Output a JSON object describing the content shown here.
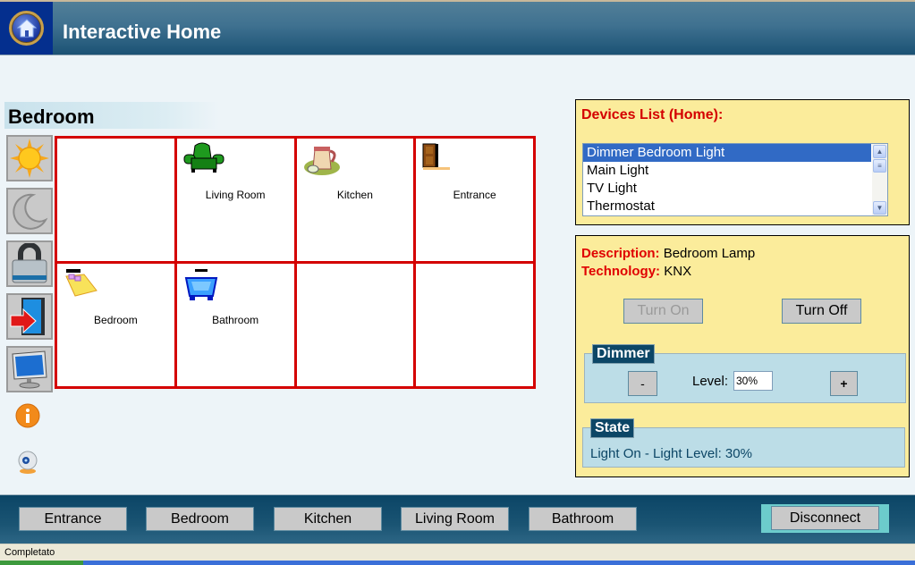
{
  "header": {
    "title": "Interactive Home",
    "logo_icon": "home-icon"
  },
  "room": {
    "title": "Bedroom"
  },
  "sidebar": {
    "buttons": [
      {
        "name": "day-scene",
        "icon": "sun-icon"
      },
      {
        "name": "night-scene",
        "icon": "moon-icon"
      },
      {
        "name": "security",
        "icon": "padlock-icon"
      },
      {
        "name": "exit",
        "icon": "exit-door-icon"
      },
      {
        "name": "tv",
        "icon": "monitor-icon"
      }
    ],
    "extras": [
      {
        "name": "info",
        "icon": "info-icon"
      },
      {
        "name": "webcam",
        "icon": "webcam-icon"
      }
    ]
  },
  "map": {
    "cells": [
      {
        "label": "",
        "icon": ""
      },
      {
        "label": "Living Room",
        "icon": "armchair-icon"
      },
      {
        "label": "Kitchen",
        "icon": "jug-icon"
      },
      {
        "label": "Entrance",
        "icon": "door-icon"
      },
      {
        "label": "Bedroom",
        "icon": "bed-icon"
      },
      {
        "label": "Bathroom",
        "icon": "bathtub-icon"
      },
      {
        "label": "",
        "icon": ""
      },
      {
        "label": "",
        "icon": ""
      }
    ]
  },
  "devices": {
    "title": "Devices List (Home):",
    "items": [
      "Dimmer Bedroom Light",
      "Main Light",
      "TV Light",
      "Thermostat"
    ],
    "selected_index": 0
  },
  "detail": {
    "description_label": "Description:",
    "description": "Bedroom Lamp",
    "technology_label": "Technology:",
    "technology": "KNX",
    "turn_on_label": "Turn On",
    "turn_off_label": "Turn Off",
    "dimmer": {
      "legend": "Dimmer",
      "minus_label": "-",
      "plus_label": "+",
      "level_label": "Level:",
      "level_value": "30%"
    },
    "state": {
      "legend": "State",
      "text": "Light On - Light Level: 30%"
    }
  },
  "footer": {
    "nav": [
      "Entrance",
      "Bedroom",
      "Kitchen",
      "Living Room",
      "Bathroom"
    ],
    "disconnect_label": "Disconnect"
  },
  "statusbar": {
    "text": "Completato"
  },
  "colors": {
    "accent_red": "#d40000",
    "panel_yellow": "#fbec9b",
    "header_blue": "#1b5274",
    "selection_blue": "#316ac5"
  }
}
